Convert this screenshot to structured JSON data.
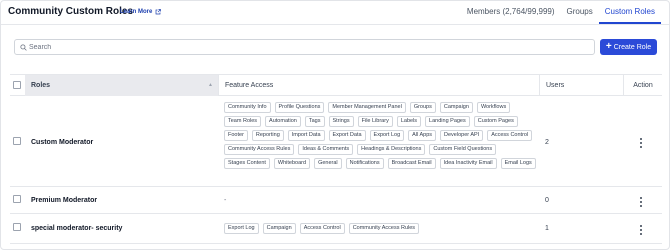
{
  "header": {
    "title": "Community Custom Roles",
    "learn_more": "Learn More",
    "tabs": [
      {
        "label": "Members (2,764/99,999)",
        "active": false
      },
      {
        "label": "Groups",
        "active": false
      },
      {
        "label": "Custom Roles",
        "active": true
      }
    ]
  },
  "toolbar": {
    "search_placeholder": "Search",
    "create_label": "Create Role"
  },
  "table": {
    "columns": [
      "Roles",
      "Feature Access",
      "Users",
      "Action"
    ],
    "rows": [
      {
        "role": "Custom Moderator",
        "features": [
          "Community Info",
          "Profile Questions",
          "Member Management Panel",
          "Groups",
          "Campaign",
          "Workflows",
          "Team Roles",
          "Automation",
          "Tags",
          "Strings",
          "File Library",
          "Labels",
          "Landing Pages",
          "Custom Pages",
          "Footer",
          "Reporting",
          "Import Data",
          "Export Data",
          "Export Log",
          "All Apps",
          "Developer API",
          "Access Control",
          "Community Access Rules",
          "Ideas & Comments",
          "Headings & Descriptions",
          "Custom Field Questions",
          "Stages Content",
          "Whiteboard",
          "General",
          "Notifications",
          "Broadcast Email",
          "Idea Inactivity Email",
          "Email Logs"
        ],
        "users": "2"
      },
      {
        "role": "Premium Moderator",
        "features_empty": "-",
        "users": "0"
      },
      {
        "role": "special moderator- security",
        "features": [
          "Export Log",
          "Campaign",
          "Access Control",
          "Community Access Rules"
        ],
        "users": "1"
      }
    ]
  },
  "colors": {
    "accent": "#2146d0",
    "button": "#2b4ad8",
    "header_cell": "#e9eaee"
  }
}
